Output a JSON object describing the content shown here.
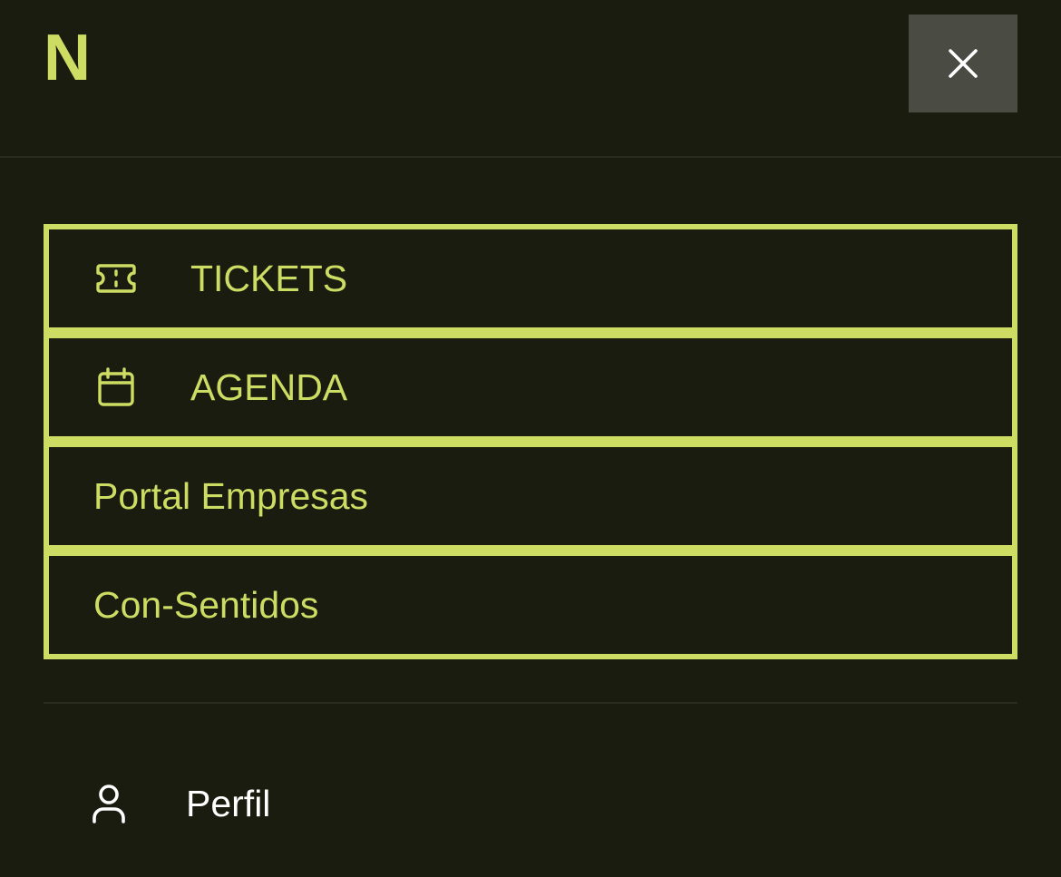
{
  "header": {
    "logo_text": "N",
    "close_icon": "close-icon"
  },
  "menu": {
    "items": [
      {
        "label": "TICKETS",
        "icon": "ticket-icon"
      },
      {
        "label": "AGENDA",
        "icon": "calendar-icon"
      },
      {
        "label": "Portal Empresas"
      },
      {
        "label": "Con-Sentidos"
      }
    ]
  },
  "profile": {
    "label": "Perfil",
    "icon": "user-icon"
  },
  "colors": {
    "background": "#1a1c10",
    "accent": "#cddc63",
    "close_button_bg": "#4a4c44",
    "profile_text": "#ffffff"
  }
}
